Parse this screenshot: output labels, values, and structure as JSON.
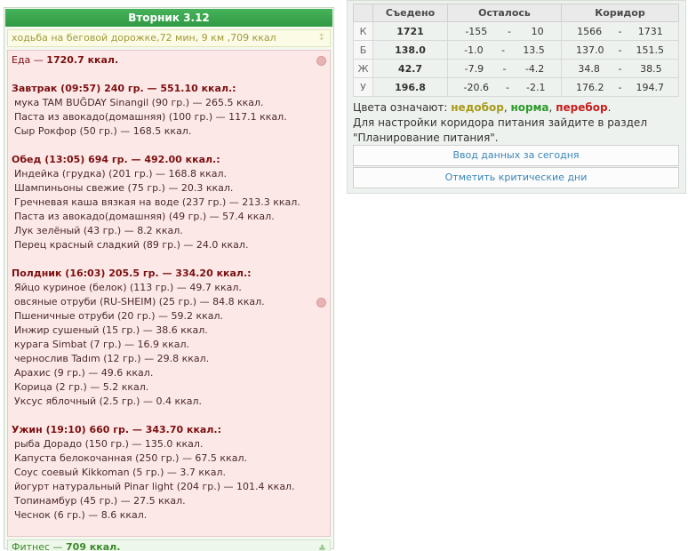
{
  "day": {
    "title": "Вторник 3.12"
  },
  "activity": {
    "text": "ходьба на беговой дорожке,72 мин, 9 км ,709 ккал"
  },
  "food": {
    "total_label": "Еда —",
    "total_value": "1720.7 ккал.",
    "meals": [
      {
        "title": "Завтрак (09:57) 240 гр. — 551.10 ккал.:",
        "items": [
          "мука TAM BUĞDAY Sinangil (90 гр.) — 265.5 ккал.",
          "Паста из авокадо(домашняя) (100 гр.) — 117.1 ккал.",
          "Сыр Рокфор (50 гр.) — 168.5 ккал."
        ]
      },
      {
        "title": "Обед (13:05) 694 гр. — 492.00 ккал.:",
        "items": [
          "Индейка (грудка) (201 гр.) — 168.8 ккал.",
          "Шампиньоны свежие (75 гр.) — 20.3 ккал.",
          "Гречневая каша вязкая на воде (237 гр.) — 213.3 ккал.",
          "Паста из авокадо(домашняя) (49 гр.) — 57.4 ккал.",
          "Лук зелёный (43 гр.) — 8.2 ккал.",
          "Перец красный сладкий (89 гр.) — 24.0 ккал."
        ]
      },
      {
        "title": "Полдник (16:03) 205.5 гр. — 334.20 ккал.:",
        "items": [
          "Яйцо куриное (белок) (113 гр.) — 49.7 ккал.",
          "овсяные отруби (RU-SHEIM) (25 гр.) — 84.8 ккал.",
          "Пшеничные отруби (20 гр.) — 59.2 ккал.",
          "Инжир сушеный (15 гр.) — 38.6 ккал.",
          "курага Simbat (7 гр.) — 16.9 ккал.",
          "чернослив Tadım (12 гр.) — 29.8 ккал.",
          "Арахис (9 гр.) — 49.6 ккал.",
          "Корица (2 гр.) — 5.2 ккал.",
          "Уксус яблочный (2.5 гр.) — 0.4 ккал."
        ]
      },
      {
        "title": "Ужин (19:10) 660 гр. — 343.70 ккал.:",
        "items": [
          "рыба Дорадо (150 гр.) — 135.0 ккал.",
          "Капуста белокочанная (250 гр.) — 67.5 ккал.",
          "Соус соевый Kikkoman (5 гр.) — 3.7 ккал.",
          "йогурт натуральный Pinar light (204 гр.) — 101.4 ккал.",
          "Топинамбур (45 гр.) — 27.5 ккал.",
          "Чеснок (6 гр.) — 8.6 ккал."
        ]
      }
    ]
  },
  "fitness": {
    "label": "Фитнес —",
    "value": "709 ккал."
  },
  "summary": {
    "headers": {
      "eaten": "Съедено",
      "left": "Осталось",
      "corridor": "Коридор"
    },
    "rows": [
      {
        "label": "К",
        "eaten": "1721",
        "eaten_status": "norm",
        "left_min": "-155",
        "left_max": "10",
        "cor_min": "1566",
        "cor_max": "1731"
      },
      {
        "label": "Б",
        "eaten": "138.0",
        "eaten_status": "norm",
        "left_min": "-1.0",
        "left_max": "13.5",
        "cor_min": "137.0",
        "cor_max": "151.5"
      },
      {
        "label": "Ж",
        "eaten": "42.7",
        "eaten_status": "over",
        "left_min": "-7.9",
        "left_max": "-4.2",
        "cor_min": "34.8",
        "cor_max": "38.5"
      },
      {
        "label": "У",
        "eaten": "196.8",
        "eaten_status": "over",
        "left_min": "-20.6",
        "left_max": "-2.1",
        "cor_min": "176.2",
        "cor_max": "194.7"
      }
    ],
    "dash": "-"
  },
  "legend": {
    "prefix": "Цвета означают:",
    "under": "недобор",
    "comma1": ",",
    "norm": "норма",
    "comma2": ",",
    "over": "перебор",
    "dot": ".",
    "hint": "Для настройки коридора питания зайдите в раздел \"Планирование питания\"."
  },
  "buttons": {
    "today": "Ввод данных за сегодня",
    "critical_days": "Отметить критические дни"
  },
  "colors": {
    "under": "#a89a1a",
    "norm": "#2a9a2a",
    "over": "#c41e1e",
    "header_green": "#46b25a"
  }
}
